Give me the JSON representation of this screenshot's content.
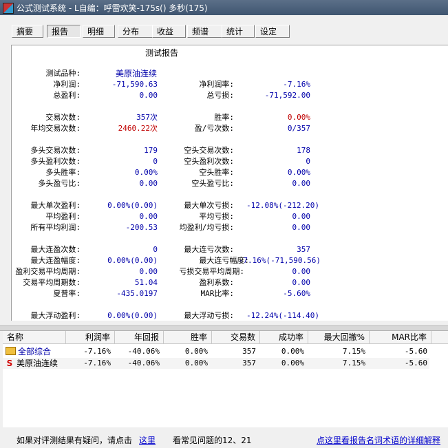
{
  "window": {
    "title": "公式测试系统 - L自编：呼雷欢笑-175s() 多秒(175)"
  },
  "tabs": [
    {
      "label": "摘要"
    },
    {
      "label": "报告"
    },
    {
      "label": "明细"
    },
    {
      "label": "分布"
    },
    {
      "label": "收益"
    },
    {
      "label": "频谱"
    },
    {
      "label": "统计"
    },
    {
      "label": "设定"
    }
  ],
  "report": {
    "title": "测试报告",
    "rows": [
      {
        "l1": "测试品种:",
        "v1": "美原油连续",
        "l2": "",
        "v2": ""
      },
      {
        "l1": "净利润:",
        "v1": "-71,590.63",
        "l2": "净利润率:",
        "v2": "-7.16%"
      },
      {
        "l1": "总盈利:",
        "v1": "0.00",
        "l2": "总亏损:",
        "v2": "-71,592.00"
      },
      {
        "l1": "交易次数:",
        "v1": "357次",
        "l2": "胜率:",
        "v2": "0.00%"
      },
      {
        "l1": "年均交易次数:",
        "v1": "2460.22次",
        "l2": "盈/亏次数:",
        "v2": "0/357"
      },
      {
        "l1": "多头交易次数:",
        "v1": "179",
        "l2": "空头交易次数:",
        "v2": "178"
      },
      {
        "l1": "多头盈利次数:",
        "v1": "0",
        "l2": "空头盈利次数:",
        "v2": "0"
      },
      {
        "l1": "多头胜率:",
        "v1": "0.00%",
        "l2": "空头胜率:",
        "v2": "0.00%"
      },
      {
        "l1": "多头盈亏比:",
        "v1": "0.00",
        "l2": "空头盈亏比:",
        "v2": "0.00"
      },
      {
        "l1": "最大单次盈利:",
        "v1": "0.00%(0.00)",
        "l2": "最大单次亏损:",
        "v2": "-12.08%(-212.20)"
      },
      {
        "l1": "平均盈利:",
        "v1": "0.00",
        "l2": "平均亏损:",
        "v2": "0.00"
      },
      {
        "l1": "所有平均利润:",
        "v1": "-200.53",
        "l2": "均盈利/均亏损:",
        "v2": "0.00"
      },
      {
        "l1": "最大连盈次数:",
        "v1": "0",
        "l2": "最大连亏次数:",
        "v2": "357"
      },
      {
        "l1": "最大连盈幅度:",
        "v1": "0.00%(0.00)",
        "l2": "最大连亏幅度:",
        "v2": "-7.16%(-71,590.56)"
      },
      {
        "l1": "盈利交易平均周期:",
        "v1": "0.00",
        "l2": "亏损交易平均周期:",
        "v2": "0.00"
      },
      {
        "l1": "交易平均周期数:",
        "v1": "51.04",
        "l2": "盈利系数:",
        "v2": "0.00"
      },
      {
        "l1": "夏普率:",
        "v1": "-435.0197",
        "l2": "MAR比率:",
        "v2": "-5.60%"
      },
      {
        "l1": "最大浮动盈利:",
        "v1": "0.00%(0.00)",
        "l2": "最大浮动亏损:",
        "v2": "-12.24%(-114.40)"
      }
    ]
  },
  "grid": {
    "headers": [
      "名称",
      "利润率",
      "年回报",
      "胜率",
      "交易数",
      "成功率",
      "最大回撤%",
      "MAR比率"
    ],
    "rows": [
      {
        "icon": "folder-icon",
        "cells": [
          "全部综合",
          "-7.16%",
          "-40.06%",
          "0.00%",
          "357",
          "0.00%",
          "7.15%",
          "-5.60"
        ]
      },
      {
        "icon": "s-icon",
        "icon_text": "S",
        "cells": [
          "美原油连续",
          "-7.16%",
          "-40.06%",
          "0.00%",
          "357",
          "0.00%",
          "7.15%",
          "-5.60"
        ]
      }
    ]
  },
  "footer": {
    "prefix": "如果对评测结果有疑问，请点击",
    "link1": "这里",
    "middle": "看常见问题的12、21",
    "link2": "点这里看报告名词术语的详细解释"
  },
  "colors": {
    "red": "#c00000",
    "blue": "#0000aa",
    "link": "#0000cc"
  }
}
